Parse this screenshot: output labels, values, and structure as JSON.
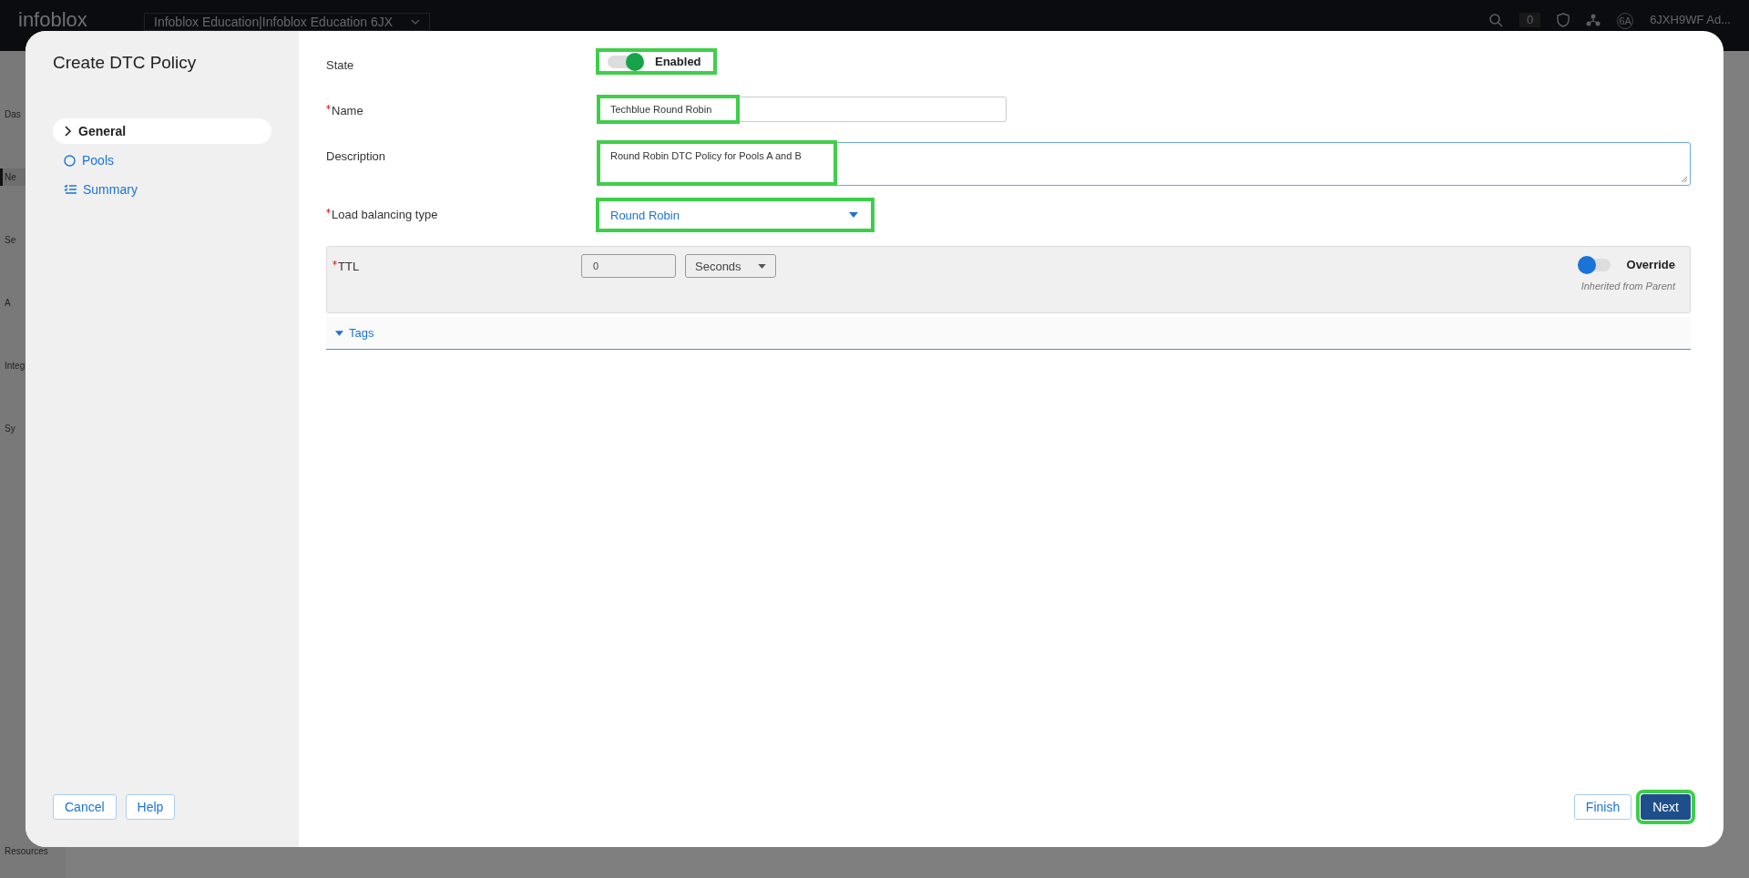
{
  "topbar": {
    "logo": "infoblox",
    "account_selector": "Infoblox Education|Infoblox Education 6JX",
    "notification_count": "0",
    "avatar": "6A",
    "user": "6JXH9WF Ad..."
  },
  "nav": [
    {
      "label": "Das",
      "selected": false
    },
    {
      "label": "Ne",
      "selected": true
    },
    {
      "label": "Se",
      "selected": false
    },
    {
      "label": "A",
      "selected": false
    },
    {
      "label": "Integ",
      "selected": false
    },
    {
      "label": "Sy",
      "selected": false
    },
    {
      "label": "Resources",
      "selected": false
    }
  ],
  "dialog": {
    "title": "Create DTC Policy",
    "steps": [
      {
        "label": "General",
        "kind": "current",
        "selected": true
      },
      {
        "label": "Pools",
        "kind": "pending",
        "selected": false
      },
      {
        "label": "Summary",
        "kind": "summary",
        "selected": false
      }
    ],
    "fields": [
      {
        "label": "State",
        "kind": "toggle",
        "required": false,
        "on": true,
        "value": "Enabled",
        "highlighted": true
      },
      {
        "label": "Name",
        "kind": "text",
        "required": true,
        "value": "Techblue Round Robin",
        "highlighted": true
      },
      {
        "label": "Description",
        "kind": "textarea",
        "required": false,
        "value": "Round Robin DTC Policy for Pools A and B",
        "highlighted": true
      },
      {
        "label": "Load balancing type",
        "kind": "select",
        "required": true,
        "value": "Round Robin",
        "highlighted": true
      }
    ],
    "ttl": {
      "label": "TTL",
      "required": true,
      "value": "0",
      "unit": "Seconds",
      "disabled": true,
      "override": {
        "label": "Override",
        "on": false,
        "note": "Inherited from Parent"
      }
    },
    "tags": {
      "label": "Tags",
      "expanded": true
    },
    "left_buttons": [
      {
        "label": "Cancel",
        "kind": "secondary",
        "highlighted": false
      },
      {
        "label": "Help",
        "kind": "secondary",
        "highlighted": false
      }
    ],
    "right_buttons": [
      {
        "label": "Finish",
        "kind": "secondary",
        "highlighted": false
      },
      {
        "label": "Next",
        "kind": "primary",
        "highlighted": true
      }
    ]
  }
}
